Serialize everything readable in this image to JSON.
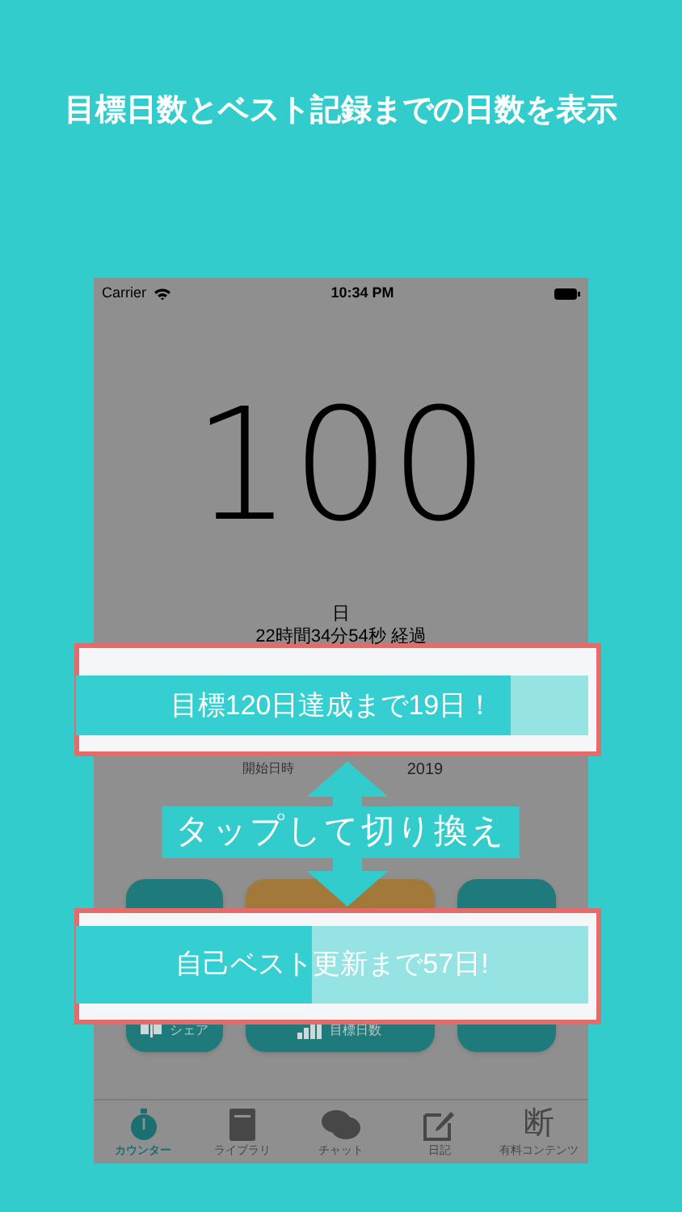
{
  "headline": "目標日数とベスト記録までの日数を表示",
  "status_bar": {
    "carrier": "Carrier",
    "time": "10:34 PM"
  },
  "counter": {
    "value": "100",
    "unit": "日",
    "elapsed": "22時間34分54秒 経過"
  },
  "start_date": {
    "label": "開始日時",
    "value": "2019"
  },
  "button_rows": [
    {
      "buttons": [
        {
          "color": "#1f7b7b"
        },
        {
          "color": "#a3793a"
        },
        {
          "color": "#1f7b7b"
        }
      ]
    },
    {
      "buttons": [
        {
          "color": "#1f7b7b",
          "label": "シェア"
        },
        {
          "color": "#1f7b7b",
          "label": "目標日数"
        },
        {
          "color": "#1f7b7b"
        }
      ]
    }
  ],
  "callouts": [
    {
      "text": "目標120日達成まで19日！",
      "level": 0.85
    },
    {
      "text": "自己ベスト更新まで57日!",
      "level": 0.46
    }
  ],
  "hint": "タップして切り換え",
  "tabs": [
    {
      "label": "カウンター",
      "selected": true
    },
    {
      "label": "ライブラリ",
      "selected": false
    },
    {
      "label": "チャット",
      "selected": false
    },
    {
      "label": "日記",
      "selected": false
    },
    {
      "label": "有料コンテンツ",
      "glyph": "断",
      "selected": false
    }
  ]
}
